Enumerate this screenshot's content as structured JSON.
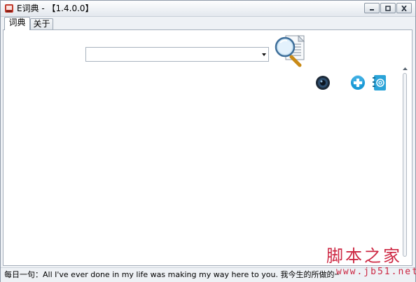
{
  "window": {
    "title": "E词典 - 【1.4.0.0】",
    "buttons": [
      "minimize",
      "maximize",
      "close"
    ]
  },
  "tabs": [
    {
      "label": "词典",
      "active": true
    },
    {
      "label": "关于",
      "active": false
    }
  ],
  "search": {
    "value": "",
    "placeholder": ""
  },
  "icons": {
    "search": "magnifier-document-icon",
    "audio": "speaker-icon",
    "add": "plus-icon",
    "contact": "address-book-icon"
  },
  "status": {
    "daily_text": "每日一句：All I've ever done in my life was making my way here to you. 我今生的所做的一切都是为了找到你"
  },
  "watermark": {
    "text": "脚本之家",
    "url": "www.jb51.net"
  },
  "colors": {
    "watermark": "#c8102e",
    "accent": "#1b9ad6"
  }
}
